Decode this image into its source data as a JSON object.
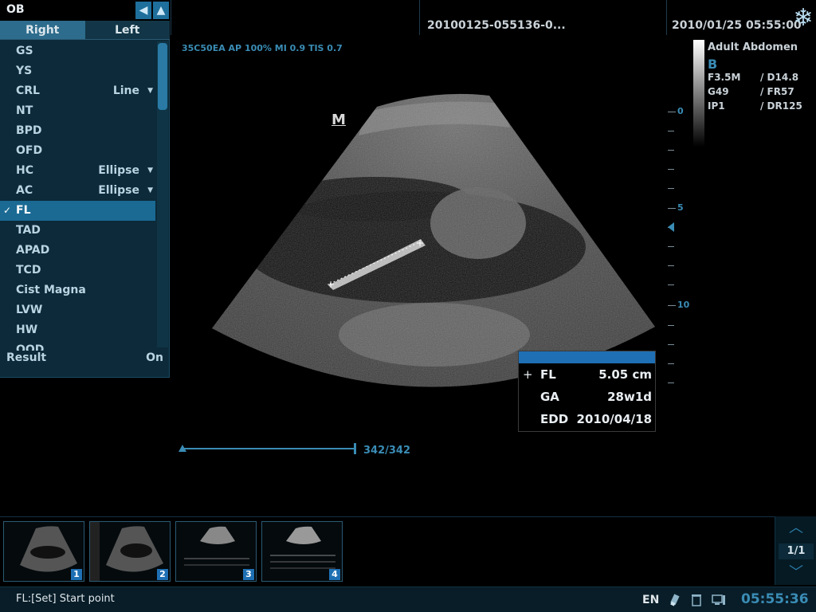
{
  "header": {
    "study_id": "20100125-055136-0...",
    "datetime": "2010/01/25  05:55:00"
  },
  "panel": {
    "title": "OB",
    "tabs": [
      {
        "label": "Right",
        "active": true
      },
      {
        "label": "Left",
        "active": false
      }
    ],
    "items": [
      {
        "label": "GS",
        "method": ""
      },
      {
        "label": "YS",
        "method": ""
      },
      {
        "label": "CRL",
        "method": "Line"
      },
      {
        "label": "NT",
        "method": ""
      },
      {
        "label": "BPD",
        "method": ""
      },
      {
        "label": "OFD",
        "method": ""
      },
      {
        "label": "HC",
        "method": "Ellipse"
      },
      {
        "label": "AC",
        "method": "Ellipse"
      },
      {
        "label": "FL",
        "method": "",
        "selected": true
      },
      {
        "label": "TAD",
        "method": ""
      },
      {
        "label": "APAD",
        "method": ""
      },
      {
        "label": "TCD",
        "method": ""
      },
      {
        "label": "Cist Magna",
        "method": ""
      },
      {
        "label": "LVW",
        "method": ""
      },
      {
        "label": "HW",
        "method": ""
      },
      {
        "label": "OOD",
        "method": ""
      }
    ],
    "result_label": "Result",
    "result_value": "On"
  },
  "params": {
    "probe_line": "35C50EA  AP 100%  MI 0.9  TIS 0.7",
    "exam_type": "Adult Abdomen",
    "mode": "B",
    "lines": [
      {
        "a": "F3.5M",
        "b": "/ D14.8"
      },
      {
        "a": "G49",
        "b": "/ FR57"
      },
      {
        "a": "IP1",
        "b": "/ DR125"
      }
    ]
  },
  "image": {
    "marker": "M",
    "depth_labels": [
      "0",
      "5",
      "10"
    ]
  },
  "measurement": {
    "rows": [
      {
        "key": "FL",
        "value": "5.05 cm",
        "cursor": true
      },
      {
        "key": "GA",
        "value": "28w1d",
        "cursor": false
      },
      {
        "key": "EDD",
        "value": "2010/04/18",
        "cursor": false
      }
    ]
  },
  "cine": {
    "frame_count": "342/342"
  },
  "thumbnails": {
    "items": [
      "1",
      "2",
      "3",
      "4"
    ],
    "page": "1/1"
  },
  "status": {
    "message": "FL:[Set] Start point",
    "language": "EN",
    "time": "05:55:36"
  },
  "colors": {
    "accent": "#3a8cb5",
    "panel_bg": "#0c2a39",
    "selected_bg": "#1a6a94",
    "result_bar": "#1e6fb3"
  }
}
